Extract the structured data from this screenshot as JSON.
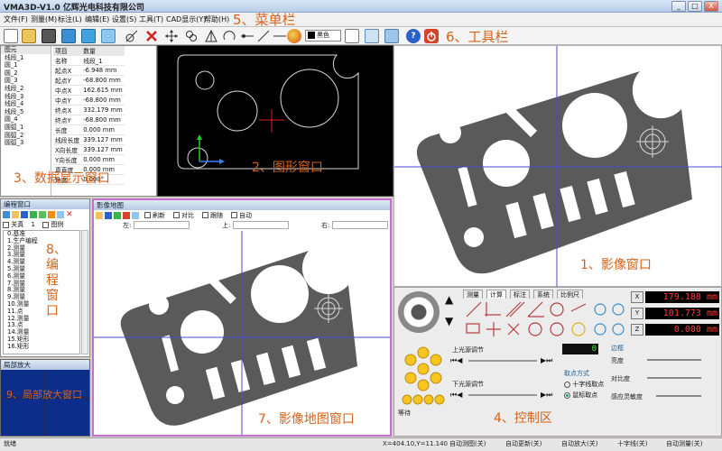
{
  "app": {
    "title": "VMA3D-V1.0 亿辉光电科技有限公司"
  },
  "window_controls": {
    "minimize": "_",
    "maximize": "□",
    "close": "X"
  },
  "menu": [
    "文件(F)",
    "测量(M)",
    "标注(L)",
    "编辑(E)",
    "设置(S)",
    "工具(T)",
    "CAD显示(Y)",
    "帮助(H)"
  ],
  "toolbar": {
    "color_select": "黑色"
  },
  "annotations": {
    "menubar": "5、菜单栏",
    "toolbar": "6、工具栏",
    "data_window": "3、数据显示窗口",
    "graphic_window": "2、图形窗口",
    "image_window": "1、影像窗口",
    "program_window": "8、编程窗口",
    "magnify_window": "9、局部放大窗口",
    "map_window": "7、影像地图窗口",
    "control_area": "4、控制区"
  },
  "element_list": {
    "header": "图元",
    "items": [
      "线段_1",
      "圆_1",
      "圆_2",
      "圆_3",
      "线段_2",
      "线段_3",
      "线段_4",
      "线段_5",
      "圆_4",
      "圆弧_1",
      "圆弧_2",
      "圆弧_3"
    ]
  },
  "property_table": {
    "headers": [
      "项目",
      "数量"
    ],
    "rows": [
      [
        "名称",
        "线段_1"
      ],
      [
        "起点X",
        "-6.948 mm"
      ],
      [
        "起点Y",
        "-68.800 mm"
      ],
      [
        "中点X",
        "162.615 mm"
      ],
      [
        "中点Y",
        "-68.800 mm"
      ],
      [
        "终点X",
        "332.179 mm"
      ],
      [
        "终点Y",
        "-68.800 mm"
      ],
      [
        "长度",
        "0.000 mm"
      ],
      [
        "线段长度",
        "339.127 mm"
      ],
      [
        "X向长度",
        "339.127 mm"
      ],
      [
        "Y向长度",
        "0.000 mm"
      ],
      [
        "真直度",
        "0.000 mm"
      ],
      [
        "角度",
        "0.000°"
      ]
    ]
  },
  "program_window": {
    "title": "编程窗口",
    "options": [
      "关真",
      "1",
      "图例"
    ],
    "items": [
      "0.基准",
      "1.生产编程",
      "2.测量",
      "3.测量",
      "4.测量",
      "5.测量",
      "6.测量",
      "7.测量",
      "8.测量",
      "9.测量",
      "10.测量",
      "11.点",
      "12.测量",
      "13.点",
      "14.测量",
      "15.矩形",
      "16.矩形"
    ]
  },
  "map_window": {
    "title": "影像地图",
    "checks": [
      "刷新",
      "对比",
      "跟随",
      "自动"
    ],
    "fields": [
      "左:",
      "上:",
      "右:"
    ]
  },
  "magnify_window": {
    "title": "局部放大"
  },
  "control": {
    "tabs": [
      "测量",
      "计算",
      "标注",
      "系统",
      "比例尺"
    ],
    "readouts": [
      {
        "axis": "X",
        "value": "179.188 mm"
      },
      {
        "axis": "Y",
        "value": "101.773 mm"
      },
      {
        "axis": "Z",
        "value": "0.000 mm"
      }
    ],
    "upper_light": "上光源调节",
    "lower_light": "下光源调节",
    "light_value": "0",
    "edge_label": "边框",
    "capture_mode": {
      "label": "取点方式",
      "options": [
        "十字线取点",
        "鼠标取点"
      ]
    },
    "sliders": [
      "亮度",
      "对比度",
      "感应灵敏度"
    ],
    "wait_label": "等待"
  },
  "status_bar": [
    "就绪",
    "X=404.10,Y=11.140",
    "自动测图(关)",
    "自动更新(关)",
    "自动放大(关)",
    "十字线(关)",
    "自动测量(关)"
  ],
  "colors": {
    "part_fill": "#5a5a5a",
    "annotation": "#d4621a",
    "crosshair": "#4a4adb",
    "graphic_bg": "#000000",
    "readout_text": "#ff3b3b"
  }
}
